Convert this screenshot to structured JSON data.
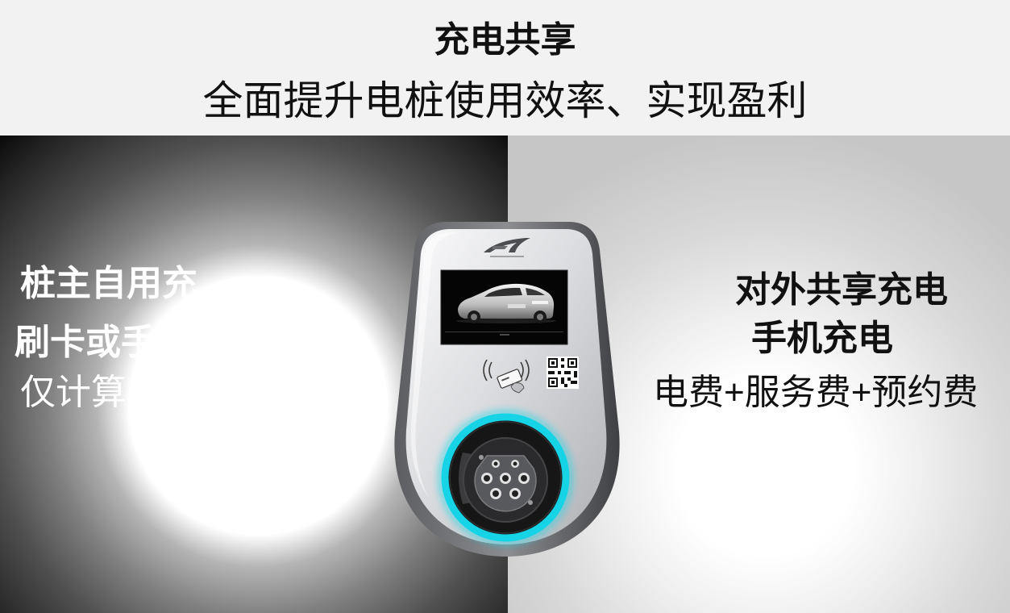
{
  "header": {
    "title": "充电共享",
    "subtitle": "全面提升电桩使用效率、实现盈利"
  },
  "left_panel": {
    "lines": [
      "桩主自用充",
      "刷卡或手",
      "仅计算"
    ]
  },
  "right_panel": {
    "lines": [
      "对外共享充电",
      "手机充电",
      "电费+服务费+预约费"
    ]
  },
  "device": {
    "icons": {
      "logo": "charger-logo-icon",
      "screen": "car-image",
      "nfc": "nfc-card-icon",
      "qr": "qr-code-icon",
      "socket": "charging-socket-icon"
    }
  },
  "colors": {
    "header_bg": "#f2f2f2",
    "left_panel_bg": "#000000",
    "right_panel_bg": "#c8c8c8",
    "socket_ring": "#16d3e6",
    "text_dark": "#111111",
    "text_light": "#ffffff"
  }
}
